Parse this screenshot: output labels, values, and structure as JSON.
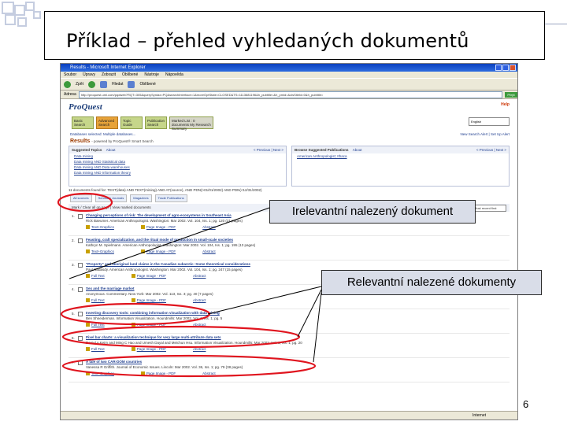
{
  "slide": {
    "title": "Příklad – přehled vyhledaných dokumentů",
    "page_number": "6"
  },
  "callouts": {
    "irrelevant": "Irelevantní nalezený dokument",
    "relevant": "Relevantní nalezené dokumenty"
  },
  "browser": {
    "window_title": "Results - Microsoft Internet Explorer",
    "menu": [
      "Soubor",
      "Úpravy",
      "Zobrazit",
      "Oblíbené",
      "Nástroje",
      "Nápověda"
    ],
    "toolbar": [
      "Zpět",
      "Hledat",
      "Oblíbené"
    ],
    "address_label": "Adresa",
    "address_url": "http://proquest.umi.com/pqdweb?RQT=305&querySyntax=PQ&searchInterface=1&moreOptState=CLOSED&TS=1113681196&h_pubtitle=&h_pmid=&clsSiteId=0&h_pubtitle=",
    "go_label": "Přejít",
    "status_left": "",
    "status_right": "Internet"
  },
  "proquest": {
    "logo": "ProQuest",
    "help": "Help",
    "tabs": [
      {
        "label": "Basic Search"
      },
      {
        "label": "Advanced Search"
      },
      {
        "label": "Topic Guide"
      },
      {
        "label": "Publication Search"
      },
      {
        "label": "Marked List : 0 documents My Research Summary"
      }
    ],
    "language_label": "Interface language:",
    "language_value": "English",
    "databases_selected": "Databases selected: Multiple databases...",
    "search_results_link": "New Search Alert | Set Up Alert",
    "results_title": "Results",
    "results_powered": "- powered by ProQuest® Smart Search",
    "suggested_topics": {
      "header": "Suggested Topics",
      "about": "About",
      "nav": "< Previous | Next >",
      "items": [
        "Data mining",
        "Data mining AND Statistical data",
        "Data mining AND Data warehouses",
        "Data mining AND Information theory"
      ]
    },
    "suggested_publications": {
      "header": "Browse Suggested Publications",
      "about": "About",
      "nav": "< Previous | Next >",
      "items": [
        "American Anthropologist; Ithaca"
      ]
    },
    "found_text": "11 documents found for: TEXT(data) AND TEXT(mining) AND AT(source), AND PDN(>01/01/2002) AND PDN(<12/31/2002)",
    "result_tabs": [
      "All sources",
      "Scholarly Journals",
      "Magazines",
      "Trade Publications"
    ],
    "mark_bar": "Mark / Clear all on page | View marked documents",
    "sort_label": "Most recent first",
    "results": [
      {
        "num": "1.",
        "title": "Changing perceptions of risk: The development of agro-ecosystems in Southeast Asia",
        "source": "Rick Baeumer. American Anthropologist. Washington: Mar 2002. Vol. 104, Iss. 1; pg. 120 (21 pages)",
        "full": "Text+Graphics",
        "pdf": "Page Image - PDF",
        "abstract": "Abstract"
      },
      {
        "num": "2.",
        "title": "Feasting, craft specialization, and the ritual mode of production in small-scale societies",
        "source": "Kathryn M. Spielmann. American Anthropologist. Washington: Mar 2002. Vol. 104, Iss. 1; pg. 195 (13 pages)",
        "full": "Text+Graphics",
        "pdf": "Page Image - PDF",
        "abstract": "Abstract"
      },
      {
        "num": "3.",
        "title": "\"Property\" and aboriginal land claims in the Canadian subarctic: Some theoretical considerations",
        "source": "Paul Nadasdy. American Anthropologist. Washington: Mar 2002. Vol. 104, Iss. 1; pg. 247 (15 pages)",
        "full": "Full Text",
        "pdf": "Page Image - PDF",
        "abstract": "Abstract"
      },
      {
        "num": "4.",
        "title": "Sex and the marriage market",
        "source": "Anonymous. Commentary. New York: Mar 2002. Vol. 113, Iss. 3; pg. 40 (7 pages)",
        "full": "Full Text",
        "pdf": "Page Image - PDF",
        "abstract": "Abstract"
      },
      {
        "num": "5.",
        "title": "Inverting discovery tools: combining information visualization with data mining",
        "source": "Ben Shneiderman. Information Visualization. Houndmills: Mar 2002. Vol. 1, Iss. 1; pg. 5",
        "full": "Full Text",
        "pdf": "Page Image - PDF",
        "abstract": "Abstract"
      },
      {
        "num": "6.",
        "title": "Pixel bar charts: a visualization technique for very large multi-attribute data sets",
        "source": "Daniel A Keim and Ming C Hao and Umesh Dayal and Meichun Hsu. Information Visualization. Houndmills: Mar 2002. Vol. 1, Iss. 1; pg. 20",
        "full": "Full Text",
        "pdf": "Page Image - PDF",
        "abstract": "Abstract"
      },
      {
        "num": "7.",
        "title": "A tale of two CAR-DOM countries",
        "source": "Vanessa R Griffith. Journal of Economic Issues. Lincoln: Mar 2002. Vol. 36, Iss. 1; pg. 79 (38 pages)",
        "full": "Text+Graphics",
        "pdf": "Page Image - PDF",
        "abstract": "Abstract"
      }
    ]
  },
  "colors": {
    "highlight_ellipse": "#e0141e",
    "callout_bg": "#d9dde8",
    "tab_active": "#e8a33a",
    "tab_green": "#c6d68a"
  }
}
